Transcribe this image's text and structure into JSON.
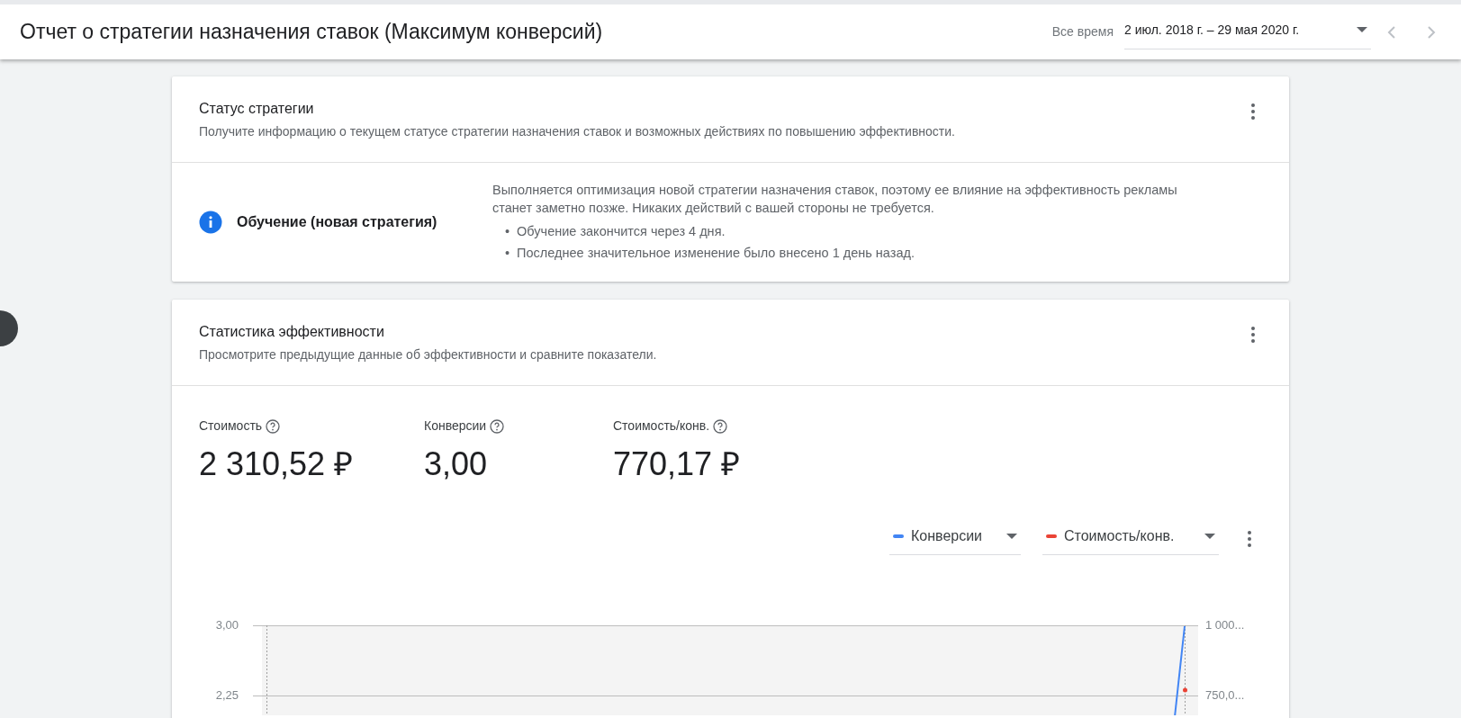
{
  "header": {
    "title": "Отчет о стратегии назначения ставок (Максимум конверсий)",
    "range_label": "Все время",
    "date_range": "2 июл. 2018 г. – 29 мая 2020 г."
  },
  "status_card": {
    "title": "Статус стратегии",
    "subtitle": "Получите информацию о текущем статусе стратегии назначения ставок и возможных действиях по повышению эффективности.",
    "status": "Обучение (новая стратегия)",
    "description": "Выполняется оптимизация новой стратегии назначения ставок, поэтому ее влияние на эффективность рекламы станет заметно позже. Никаких действий с вашей стороны не требуется.",
    "bullets": [
      {
        "marker": "•",
        "text": "Обучение закончится через 4 дня."
      },
      {
        "marker": "•",
        "text": "Последнее значительное изменение было внесено 1 день назад."
      }
    ]
  },
  "performance_card": {
    "title": "Статистика эффективности",
    "subtitle": "Просмотрите предыдущие данные об эффективности и сравните показатели.",
    "metrics": [
      {
        "label": "Стоимость",
        "value": "2 310,52 ₽"
      },
      {
        "label": "Конверсии",
        "value": "3,00"
      },
      {
        "label": "Стоимость/конв.",
        "value": "770,17 ₽"
      }
    ],
    "series_selectors": [
      {
        "label": "Конверсии",
        "color": "#4285f4"
      },
      {
        "label": "Стоимость/конв.",
        "color": "#ea4335"
      }
    ],
    "left_axis_ticks": [
      "3,00",
      "2,25"
    ],
    "right_axis_ticks": [
      "1 000...",
      "750,0..."
    ]
  }
}
